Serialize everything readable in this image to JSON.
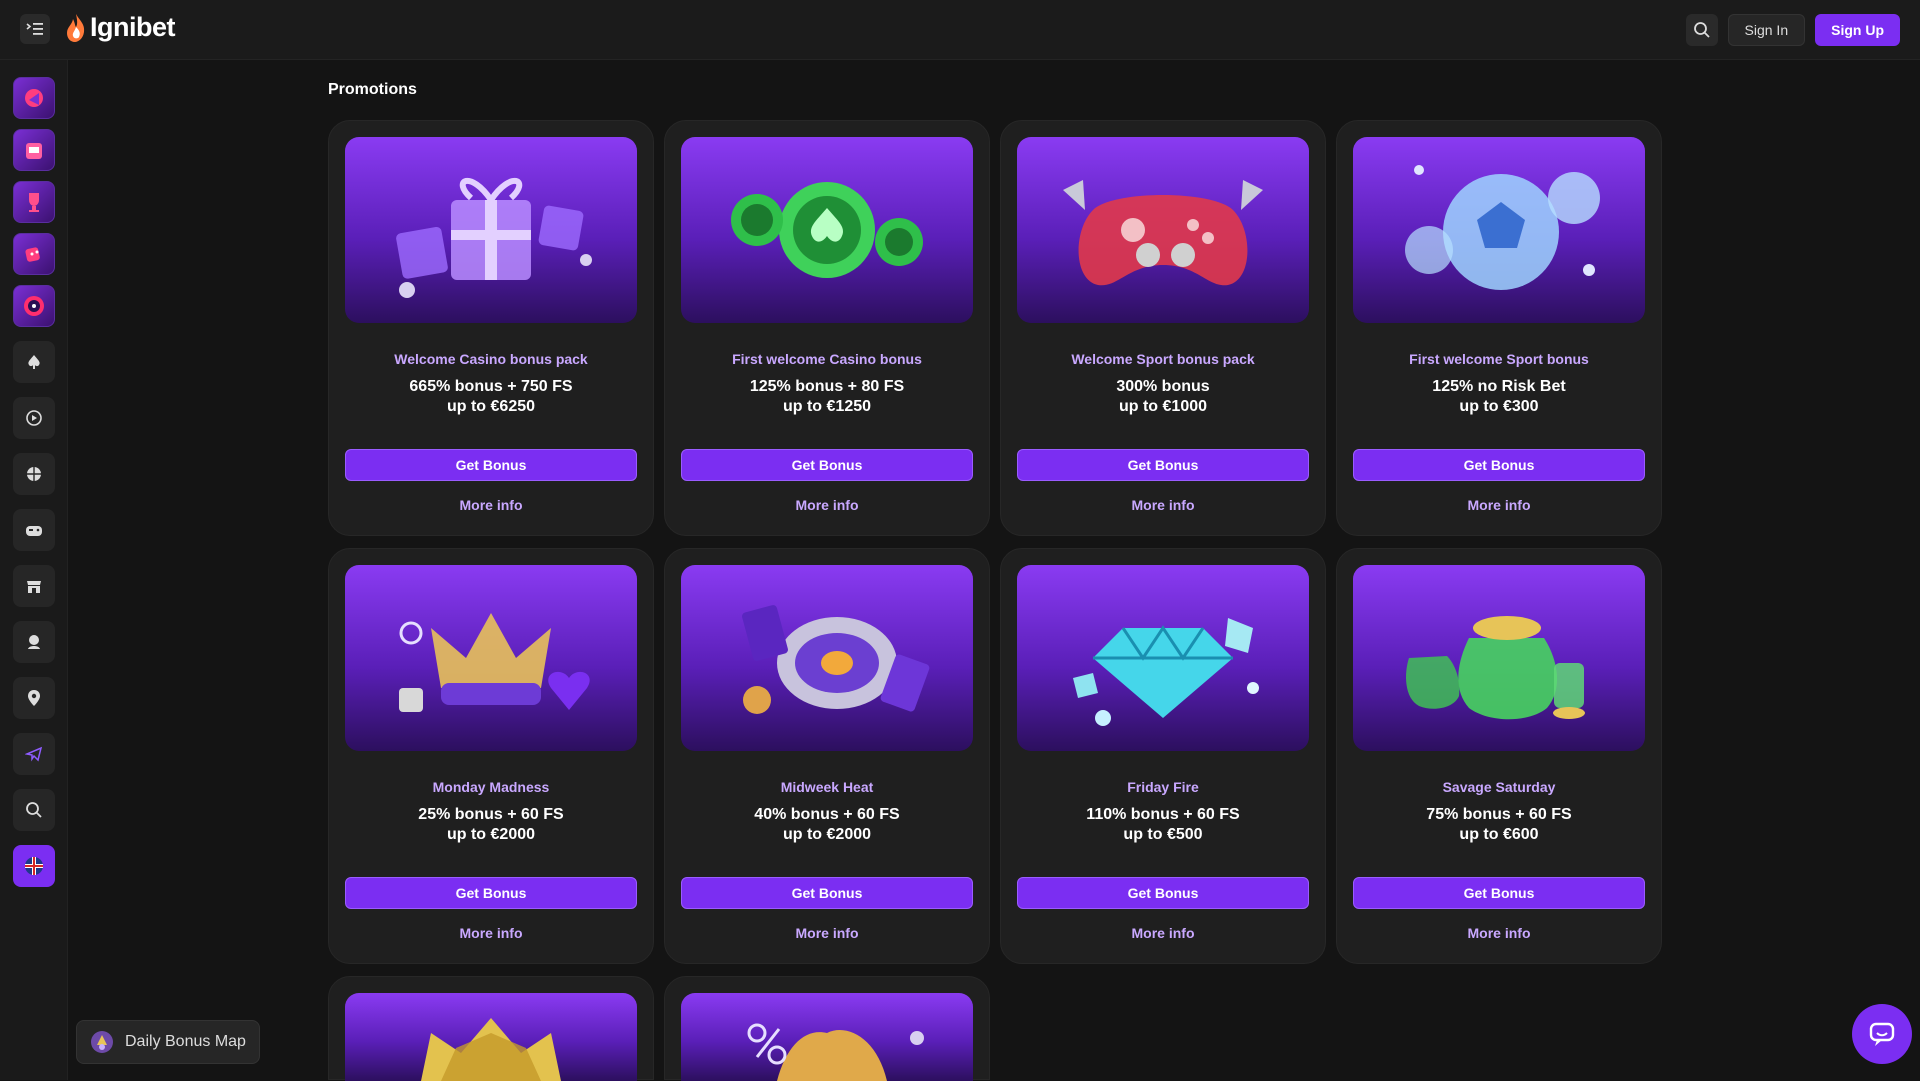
{
  "header": {
    "logo_text": "Ignibet",
    "sign_in": "Sign In",
    "sign_up": "Sign Up"
  },
  "page": {
    "title": "Promotions"
  },
  "promotions": [
    {
      "title": "Welcome Casino bonus pack",
      "offer_line1": "665% bonus + 750 FS",
      "offer_line2": "up to €6250",
      "cta": "Get Bonus",
      "more": "More info",
      "art": "gift-boxes"
    },
    {
      "title": "First welcome Casino bonus",
      "offer_line1": "125% bonus + 80 FS",
      "offer_line2": "up to €1250",
      "cta": "Get Bonus",
      "more": "More info",
      "art": "casino-chips"
    },
    {
      "title": "Welcome Sport bonus pack",
      "offer_line1": "300% bonus",
      "offer_line2": "up to €1000",
      "cta": "Get Bonus",
      "more": "More info",
      "art": "gamepad"
    },
    {
      "title": "First welcome Sport bonus",
      "offer_line1": "125% no Risk Bet",
      "offer_line2": "up to €300",
      "cta": "Get Bonus",
      "more": "More info",
      "art": "soccer-ball"
    },
    {
      "title": "Monday Madness",
      "offer_line1": "25% bonus + 60 FS",
      "offer_line2": "up to €2000",
      "cta": "Get Bonus",
      "more": "More info",
      "art": "crown"
    },
    {
      "title": "Midweek Heat",
      "offer_line1": "40% bonus + 60 FS",
      "offer_line2": "up to €2000",
      "cta": "Get Bonus",
      "more": "More info",
      "art": "roulette"
    },
    {
      "title": "Friday Fire",
      "offer_line1": "110% bonus + 60 FS",
      "offer_line2": "up to €500",
      "cta": "Get Bonus",
      "more": "More info",
      "art": "diamond"
    },
    {
      "title": "Savage Saturday",
      "offer_line1": "75% bonus + 60 FS",
      "offer_line2": "up to €600",
      "cta": "Get Bonus",
      "more": "More info",
      "art": "money-bags"
    }
  ],
  "partial_cards": [
    {
      "art": "gold-crown"
    },
    {
      "art": "percent-cashback"
    }
  ],
  "sidebar": {
    "items": [
      "promotions",
      "casino",
      "tournaments",
      "live-casino",
      "wheel",
      "poker",
      "play",
      "sports",
      "esports",
      "store",
      "support",
      "location",
      "telegram",
      "search",
      "language"
    ]
  },
  "daily_bonus_map": {
    "label": "Daily Bonus Map"
  },
  "colors": {
    "accent": "#7b2ef2",
    "card_bg": "#1f1f1f",
    "title_color": "#c9a8ff",
    "page_bg": "#141414"
  }
}
